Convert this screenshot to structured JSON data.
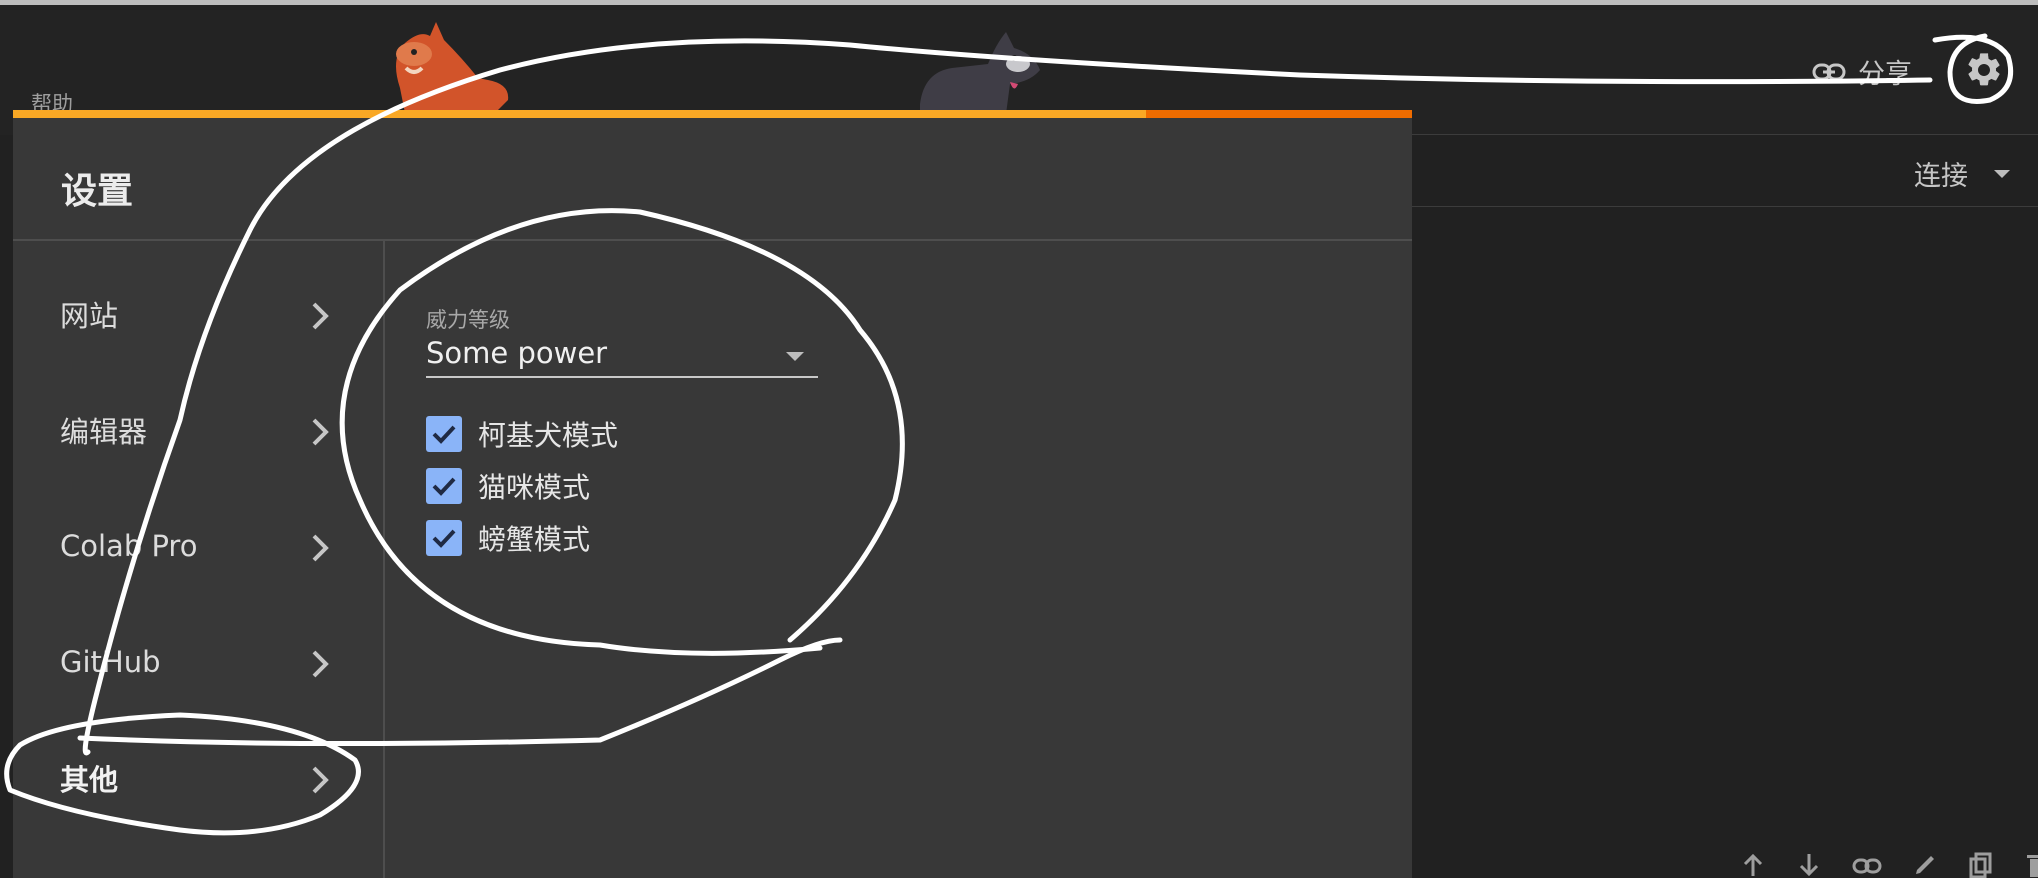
{
  "topbar": {
    "help_label": "帮助",
    "share_label": "分享",
    "share_icon": "link-icon",
    "settings_icon": "gear-icon"
  },
  "toolbar": {
    "connect_label": "连接",
    "cell_icons": [
      "arrow-up-icon",
      "arrow-down-icon",
      "link-icon",
      "pencil-icon",
      "copy-icon",
      "trash-icon"
    ]
  },
  "dialog": {
    "title": "设置",
    "nav": [
      {
        "label": "网站",
        "active": false
      },
      {
        "label": "编辑器",
        "active": false
      },
      {
        "label": "Colab Pro",
        "active": false
      },
      {
        "label": "GitHub",
        "active": false
      },
      {
        "label": "其他",
        "active": true
      }
    ],
    "power_level": {
      "label": "威力等级",
      "value": "Some power"
    },
    "checkboxes": [
      {
        "label": "柯基犬模式",
        "checked": true
      },
      {
        "label": "猫咪模式",
        "checked": true
      },
      {
        "label": "螃蟹模式",
        "checked": true
      }
    ]
  },
  "colors": {
    "accent_orange": "#f9a825",
    "accent_orange_dark": "#ef6c00",
    "checkbox_blue": "#8ab4f8",
    "dialog_bg": "#383838",
    "page_bg": "#212121"
  }
}
